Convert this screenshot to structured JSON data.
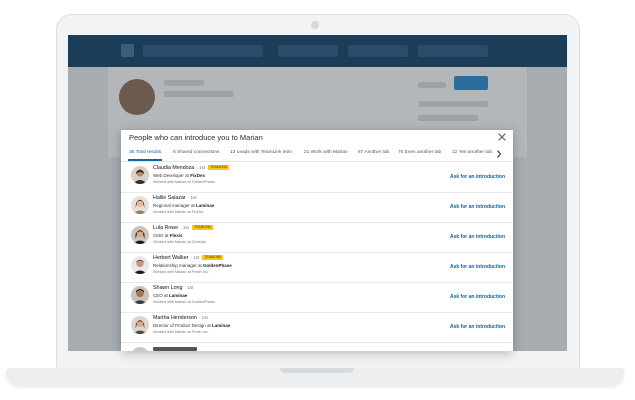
{
  "modal": {
    "title": "People who can introduce you to Marian",
    "tabs": [
      {
        "label": "36 Total results",
        "active": true
      },
      {
        "label": "8 Shared connections"
      },
      {
        "label": "13 Leads with TeamLink intro"
      },
      {
        "label": "21 Work with Marian"
      },
      {
        "label": "67 Another tab"
      },
      {
        "label": "76 Even another tab"
      },
      {
        "label": "12 Yes another tab"
      }
    ],
    "people": [
      {
        "name": "Claudia Mendoza",
        "degree": "· 1st",
        "badge": "TEAMLINK",
        "role_prefix": "Web Developer at ",
        "company": "FixDex",
        "worked": "Worked with Marian at GoldenPhase",
        "action": "Ask for an introduction"
      },
      {
        "name": "Hallie Salazar",
        "degree": "· 1st",
        "badge": "",
        "role_prefix": "Regional manager at ",
        "company": "Laminae",
        "worked": "Worked with Marian at FixDex",
        "action": "Ask for an introduction"
      },
      {
        "name": "Lula Rowe",
        "degree": "· 1st",
        "badge": "TEAMLINK",
        "role_prefix": "CMO at ",
        "company": "Flexis",
        "worked": "Worked with Marian at Zoomjax",
        "action": "Ask for an introduction"
      },
      {
        "name": "Herbert Walker",
        "degree": "· 1st",
        "badge": "TEAMLINK",
        "role_prefix": "Relationship manager at ",
        "company": "GoldenPhase",
        "worked": "Worked with Marian at Fresh Inc.",
        "action": "Ask for an introduction"
      },
      {
        "name": "Shawn Long",
        "degree": "· 1st",
        "badge": "",
        "role_prefix": "CEO at ",
        "company": "Laminae",
        "worked": "Worked with Marian at GoldenPhase",
        "action": "Ask for an introduction"
      },
      {
        "name": "Martha Henderson",
        "degree": "· 1st",
        "badge": "",
        "role_prefix": "Director of Product Design at ",
        "company": "Laminae",
        "worked": "Worked with Marian at Fresh Inc.",
        "action": "Ask for an introduction"
      }
    ]
  },
  "icons": {
    "close": "close-icon",
    "tabs_next": "chevron-right-icon"
  },
  "colors": {
    "accent": "#0a66a8",
    "badge": "#f5c518",
    "topbar": "#1c3d57"
  }
}
